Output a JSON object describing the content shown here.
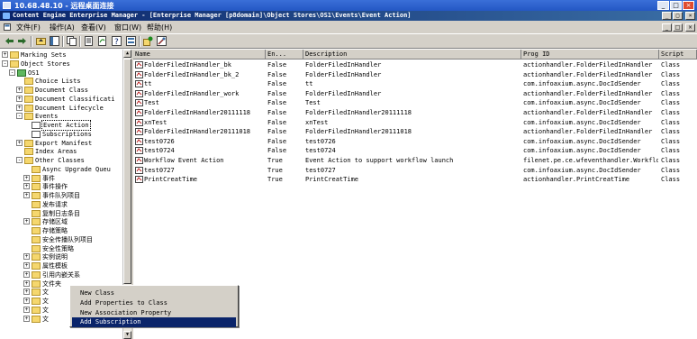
{
  "rdp": {
    "title": "10.68.48.10 - 远程桌面连接",
    "min": "_",
    "max": "□",
    "close": "×"
  },
  "app": {
    "title": "Content Engine Enterprise Manager - [Enterprise Manager [p8domain]\\Object Stores\\OS1\\Events\\Event Action]",
    "min": "_",
    "max": "□",
    "close": "×"
  },
  "menu": {
    "file": "文件(F)",
    "action": "操作(A)",
    "view": "查看(V)",
    "window": "窗口(W)",
    "help": "帮助(H)",
    "inner_min": "_",
    "inner_max": "□",
    "inner_close": "×"
  },
  "tree": {
    "items": [
      {
        "label": "Marking Sets",
        "expander": "+"
      },
      {
        "label": "Object Stores",
        "expander": "-"
      },
      {
        "label": "OS1",
        "expander": "-"
      },
      {
        "label": "Choice Lists",
        "expander": ""
      },
      {
        "label": "Document Class",
        "expander": "+"
      },
      {
        "label": "Document Classificati",
        "expander": "+"
      },
      {
        "label": "Document Lifecycle",
        "expander": "+"
      },
      {
        "label": "Events",
        "expander": "-"
      },
      {
        "label": "Event Action",
        "expander": ""
      },
      {
        "label": "Subscriptions",
        "expander": ""
      },
      {
        "label": "Export Manifest",
        "expander": "+"
      },
      {
        "label": "Index Areas",
        "expander": ""
      },
      {
        "label": "Other Classes",
        "expander": "-"
      },
      {
        "label": "Async Upgrade Queu",
        "expander": ""
      },
      {
        "label": "事件",
        "expander": "+"
      },
      {
        "label": "事件操作",
        "expander": "+"
      },
      {
        "label": "事件队列项目",
        "expander": "+"
      },
      {
        "label": "发布请求",
        "expander": ""
      },
      {
        "label": "复制日志条目",
        "expander": ""
      },
      {
        "label": "存储区域",
        "expander": "+"
      },
      {
        "label": "存储策略",
        "expander": ""
      },
      {
        "label": "安全传播队列项目",
        "expander": ""
      },
      {
        "label": "安全性策略",
        "expander": ""
      },
      {
        "label": "实例说明",
        "expander": "+"
      },
      {
        "label": "属性模板",
        "expander": "+"
      },
      {
        "label": "引用内嵌关系",
        "expander": "+"
      },
      {
        "label": "文件夹",
        "expander": "+"
      },
      {
        "label": "文",
        "expander": "+"
      },
      {
        "label": "文",
        "expander": "+"
      },
      {
        "label": "文",
        "expander": "+"
      },
      {
        "label": "文",
        "expander": "+"
      }
    ]
  },
  "list": {
    "columns": [
      "Name",
      "En...",
      "Description",
      "Prog ID",
      "Script"
    ],
    "rows": [
      [
        "FolderFiledInHandler_bk",
        "False",
        "FolderFiledInHandler",
        "actionhandler.FolderFiledInHandler",
        "Class"
      ],
      [
        "FolderFiledInHandler_bk_2",
        "False",
        "FolderFiledInHandler",
        "actionhandler.FolderFiledInHandler",
        "Class"
      ],
      [
        "tt",
        "False",
        "tt",
        "com.infoaxium.async.DocIdSender",
        "Class"
      ],
      [
        "FolderFiledInHandler_work",
        "False",
        "FolderFiledInHandler",
        "actionhandler.FolderFiledInHandler",
        "Class"
      ],
      [
        "Test",
        "False",
        "Test",
        "com.infoaxium.async.DocIdSender",
        "Class"
      ],
      [
        "FolderFiledInHandler20111118",
        "False",
        "FolderFiledInHandler20111118",
        "actionhandler.FolderFiledInHandler",
        "Class"
      ],
      [
        "xnTest",
        "False",
        "xnTest",
        "com.infoaxium.async.DocIdSender",
        "Class"
      ],
      [
        "FolderFiledInHandler20111018",
        "False",
        "FolderFiledInHandler20111018",
        "actionhandler.FolderFiledInHandler",
        "Class"
      ],
      [
        "test0726",
        "False",
        "test0726",
        "com.infoaxium.async.DocIdSender",
        "Class"
      ],
      [
        "test0724",
        "False",
        "test0724",
        "com.infoaxium.async.DocIdSender",
        "Class"
      ],
      [
        "Workflow Event Action",
        "True",
        "Event Action to support workflow launch",
        "filenet.pe.ce.wfeventhandler.Workflo...",
        "Class"
      ],
      [
        "test0727",
        "True",
        "test0727",
        "com.infoaxium.async.DocIdSender",
        "Class"
      ],
      [
        "PrintCreatTime",
        "True",
        "PrintCreatTime",
        "actionhandler.PrintCreatTime",
        "Class"
      ]
    ]
  },
  "context_menu": {
    "items": [
      "New Class",
      "Add Properties to Class",
      "New Association Property",
      "Add Subscription"
    ],
    "highlighted": "Add Subscription"
  },
  "icons": {
    "back": "back-arrow-icon",
    "forward": "forward-arrow-icon",
    "up": "up-folder-icon",
    "show_tree": "show-tree-icon",
    "copy": "copy-icon",
    "paste": "paste-icon",
    "properties": "properties-icon",
    "refresh": "refresh-icon",
    "export": "export-list-icon",
    "help": "help-icon",
    "new": "new-item-icon",
    "tools": "tools-icon"
  },
  "colors": {
    "title_bar": "#0a246a",
    "rdp_bar": "#2457c4",
    "highlight": "#0a246a",
    "chrome": "#d4d0c8"
  }
}
